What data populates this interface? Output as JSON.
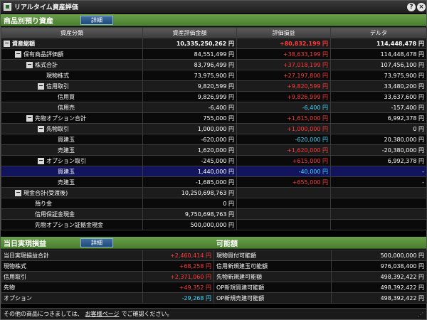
{
  "window": {
    "title": "リアルタイム資産評価",
    "help": "?",
    "close": "×"
  },
  "assets": {
    "title": "商品別預り資産",
    "detail": "詳細",
    "columns": [
      "資産分類",
      "資産評価金額",
      "評価損益",
      "デルタ"
    ],
    "rows": [
      {
        "lvl": 0,
        "tg": "−",
        "label": "資産総額",
        "v": "10,335,250,262 円",
        "p": "+80,832,199 円",
        "pc": "red",
        "d": "114,448,478 円",
        "bold": true
      },
      {
        "lvl": 1,
        "tg": "−",
        "label": "保有商品評価額",
        "v": "84,551,499 円",
        "p": "+38,633,199 円",
        "pc": "red",
        "d": "114,448,478 円"
      },
      {
        "lvl": 2,
        "tg": "−",
        "label": "株式合計",
        "v": "83,796,499 円",
        "p": "+37,018,199 円",
        "pc": "red",
        "d": "107,456,100 円"
      },
      {
        "lvl": 3,
        "tg": "",
        "label": "現物株式",
        "v": "73,975,900 円",
        "p": "+27,197,800 円",
        "pc": "red",
        "d": "73,975,900 円"
      },
      {
        "lvl": 3,
        "tg": "−",
        "label": "信用取引",
        "v": "9,820,599 円",
        "p": "+9,820,599 円",
        "pc": "red",
        "d": "33,480,200 円"
      },
      {
        "lvl": 4,
        "tg": "",
        "label": "信用買",
        "v": "9,826,999 円",
        "p": "+9,826,999 円",
        "pc": "red",
        "d": "33,637,600 円"
      },
      {
        "lvl": 4,
        "tg": "",
        "label": "信用売",
        "v": "-6,400 円",
        "p": "-6,400 円",
        "pc": "cyan",
        "d": "-157,400 円"
      },
      {
        "lvl": 2,
        "tg": "−",
        "label": "先物オプション合計",
        "v": "755,000 円",
        "p": "+1,615,000 円",
        "pc": "red",
        "d": "6,992,378 円"
      },
      {
        "lvl": 3,
        "tg": "−",
        "label": "先物取引",
        "v": "1,000,000 円",
        "p": "+1,000,000 円",
        "pc": "red",
        "d": "0 円"
      },
      {
        "lvl": 4,
        "tg": "",
        "label": "買建玉",
        "v": "-620,000 円",
        "p": "-620,000 円",
        "pc": "cyan",
        "d": "20,380,000 円"
      },
      {
        "lvl": 4,
        "tg": "",
        "label": "売建玉",
        "v": "1,620,000 円",
        "p": "+1,620,000 円",
        "pc": "red",
        "d": "-20,380,000 円"
      },
      {
        "lvl": 3,
        "tg": "−",
        "label": "オプション取引",
        "v": "-245,000 円",
        "p": "+615,000 円",
        "pc": "red",
        "d": "6,992,378 円"
      },
      {
        "lvl": 4,
        "tg": "",
        "label": "買建玉",
        "v": "1,440,000 円",
        "p": "-40,000 円",
        "pc": "cyan",
        "d": "-",
        "sel": true
      },
      {
        "lvl": 4,
        "tg": "",
        "label": "売建玉",
        "v": "-1,685,000 円",
        "p": "+655,000 円",
        "pc": "red",
        "d": "-"
      },
      {
        "lvl": 1,
        "tg": "−",
        "label": "現金合計(受渡後)",
        "v": "10,250,698,763 円",
        "p": "",
        "pc": "red",
        "d": ""
      },
      {
        "lvl": 2,
        "tg": "",
        "label": "預り金",
        "v": "0 円",
        "p": "",
        "pc": "red",
        "d": ""
      },
      {
        "lvl": 2,
        "tg": "",
        "label": "信用保証金現金",
        "v": "9,750,698,763 円",
        "p": "",
        "pc": "red",
        "d": ""
      },
      {
        "lvl": 2,
        "tg": "",
        "label": "先物オプション証拠金現金",
        "v": "500,000,000 円",
        "p": "",
        "pc": "red",
        "d": ""
      }
    ]
  },
  "realized": {
    "title": "当日実現損益",
    "detail": "詳細",
    "rows": [
      {
        "label": "当日実現損益合計",
        "v": "+2,460,414 円",
        "c": "red"
      },
      {
        "label": "現物株式",
        "v": "+68,258 円",
        "c": "red"
      },
      {
        "label": "信用取引",
        "v": "+2,371,060 円",
        "c": "red"
      },
      {
        "label": "先物",
        "v": "+49,352 円",
        "c": "red"
      },
      {
        "label": "オプション",
        "v": "-29,268 円",
        "c": "cyan"
      }
    ]
  },
  "capacity": {
    "title": "可能額",
    "rows": [
      {
        "label": "現物買付可能額",
        "v": "500,000,000 円"
      },
      {
        "label": "信用新規建玉可能額",
        "v": "976,038,400 円"
      },
      {
        "label": "先物新規建可能額",
        "v": "498,392,422 円"
      },
      {
        "label": "OP新規買建可能額",
        "v": "498,392,422 円"
      },
      {
        "label": "OP新規売建可能額",
        "v": "498,392,422 円"
      }
    ]
  },
  "footer": {
    "pre": "その他の商品につきましては、",
    "link": "お客様ページ",
    "post": "でご確認ください。"
  },
  "colors": {
    "header": "#5a8f3c",
    "positive": "#ff3b3b",
    "negative": "#3fd8ff",
    "selected": "#12145e"
  }
}
